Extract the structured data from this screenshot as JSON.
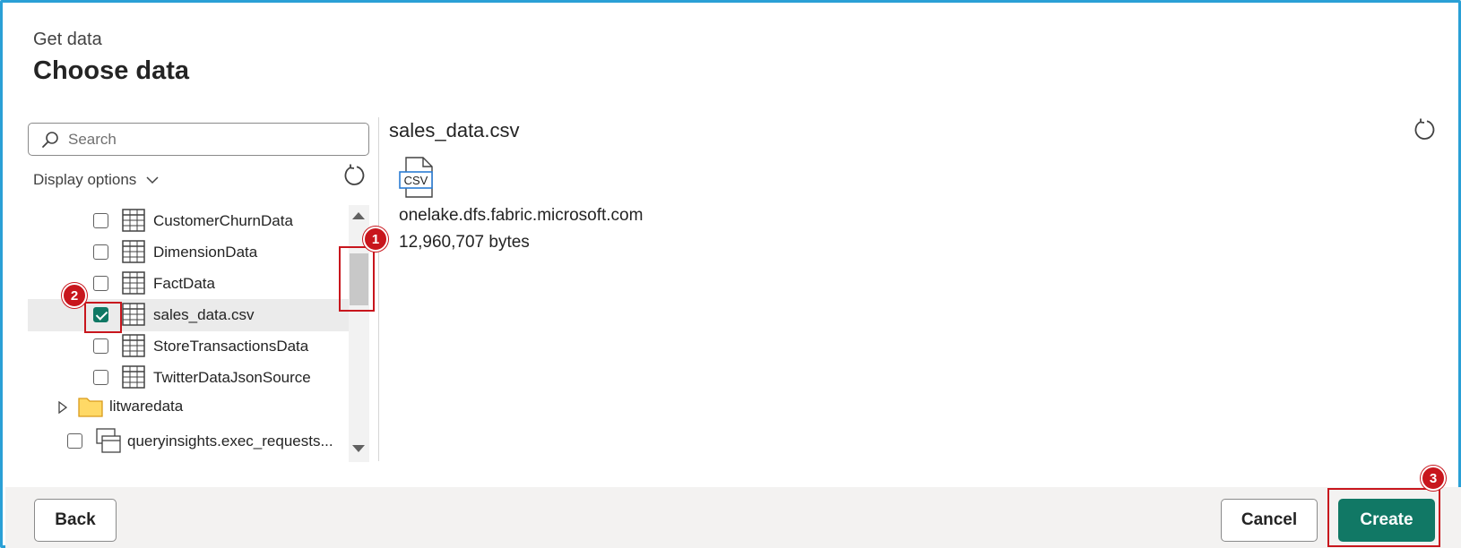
{
  "header": {
    "subtitle": "Get data",
    "title": "Choose data"
  },
  "search": {
    "placeholder": "Search"
  },
  "display_options": {
    "label": "Display options"
  },
  "tree": {
    "items": [
      {
        "label": "CustomerChurnData",
        "type": "table",
        "checked": false
      },
      {
        "label": "DimensionData",
        "type": "table",
        "checked": false
      },
      {
        "label": "FactData",
        "type": "table",
        "checked": false
      },
      {
        "label": "sales_data.csv",
        "type": "table",
        "checked": true
      },
      {
        "label": "StoreTransactionsData",
        "type": "table",
        "checked": false
      },
      {
        "label": "TwitterDataJsonSource",
        "type": "table",
        "checked": false
      },
      {
        "label": "litwaredata",
        "type": "folder"
      },
      {
        "label": "queryinsights.exec_requests...",
        "type": "view",
        "checked": false
      }
    ]
  },
  "preview": {
    "file_name": "sales_data.csv",
    "file_type_badge": "CSV",
    "host": "onelake.dfs.fabric.microsoft.com",
    "size": "12,960,707 bytes"
  },
  "footer": {
    "back_label": "Back",
    "cancel_label": "Cancel",
    "create_label": "Create"
  },
  "annotations": {
    "badge_1": "1",
    "badge_2": "2",
    "badge_3": "3"
  },
  "colors": {
    "accent": "#117865",
    "highlight": "#c8161d",
    "frame": "#2aa0d6"
  }
}
